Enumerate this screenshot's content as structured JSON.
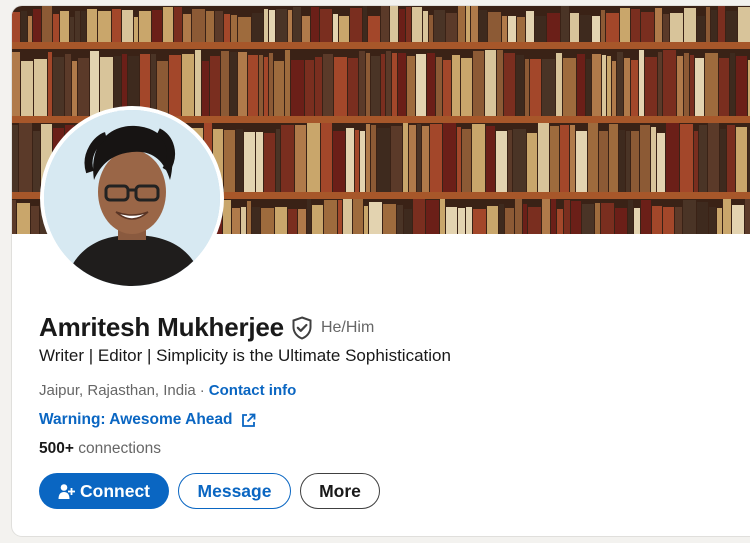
{
  "profile": {
    "name": "Amritesh Mukherjee",
    "pronouns": "He/Him",
    "headline": "Writer | Editor | Simplicity is the Ultimate Sophistication",
    "location": "Jaipur, Rajasthan, India",
    "separator": "·",
    "contact_info": "Contact info",
    "website": "Warning: Awesome Ahead",
    "connections_count": "500+",
    "connections_label": "connections"
  },
  "actions": {
    "connect": "Connect",
    "message": "Message",
    "more": "More"
  },
  "icons": {
    "verified": "verified-shield-icon",
    "external_link": "external-link-icon",
    "add_person": "add-person-icon"
  },
  "colors": {
    "brand_blue": "#0a66c2",
    "text_primary": "#191919",
    "text_secondary": "#666666"
  }
}
